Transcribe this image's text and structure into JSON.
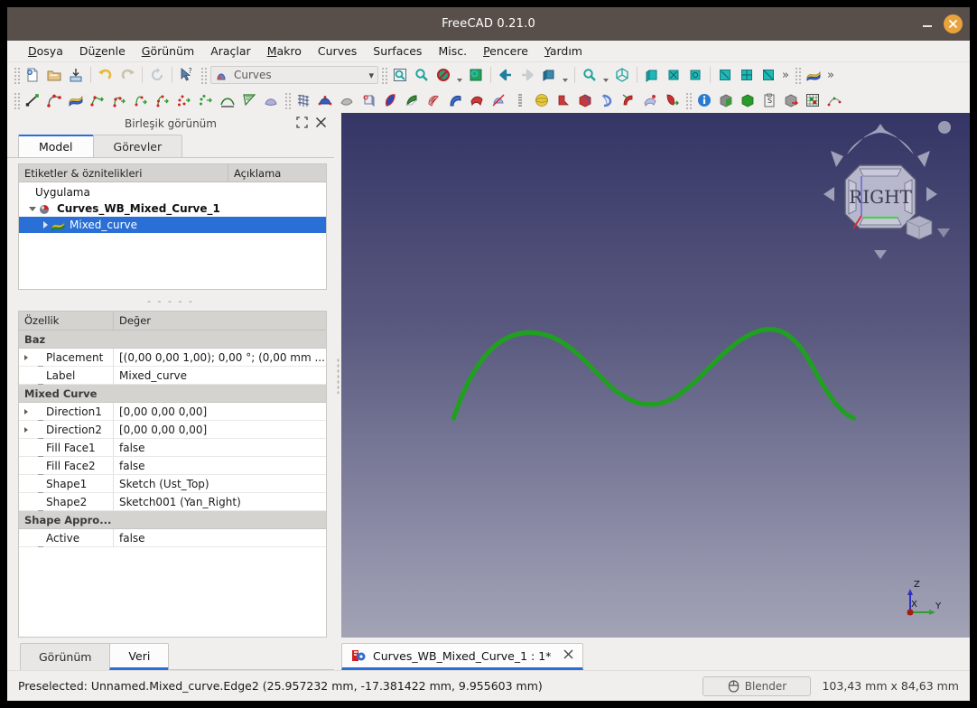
{
  "window": {
    "title": "FreeCAD 0.21.0",
    "minimize_label": "—",
    "close_label": "✕"
  },
  "menubar": {
    "items": [
      {
        "label": "Dosya",
        "accel": "D"
      },
      {
        "label": "Düzenle",
        "accel": "z"
      },
      {
        "label": "Görünüm",
        "accel": "G"
      },
      {
        "label": "Araçlar",
        "accel": ""
      },
      {
        "label": "Makro",
        "accel": "M"
      },
      {
        "label": "Curves",
        "accel": ""
      },
      {
        "label": "Surfaces",
        "accel": ""
      },
      {
        "label": "Misc.",
        "accel": ""
      },
      {
        "label": "Pencere",
        "accel": "P"
      },
      {
        "label": "Yardım",
        "accel": "Y"
      }
    ]
  },
  "toolbar": {
    "workbench_selector": {
      "value": "Curves",
      "icon": "curves-workbench-icon"
    },
    "file_tools": [
      "new-document-icon",
      "open-document-icon",
      "save-document-icon"
    ],
    "edit_tools": [
      "undo-icon",
      "redo-icon",
      "refresh-icon",
      "whats-this-icon"
    ],
    "view_tools": [
      "fit-all-icon",
      "fit-selection-icon",
      "draw-style-icon",
      "view-section-icon"
    ],
    "nav_tools": [
      "back-arrow-icon",
      "forward-arrow-icon",
      "axonometric-icon",
      "zoom-icon",
      "isometric-icon"
    ],
    "std_views": [
      "front-view-icon",
      "top-view-icon",
      "right-view-icon",
      "rear-view-icon",
      "bottom-view-icon",
      "left-view-icon"
    ],
    "overflow_label": "»"
  },
  "left_panel": {
    "header_title": "Birleşik görünüm",
    "float_icon": "float-window-icon",
    "close_icon": "close-panel-icon",
    "tabs": [
      {
        "label": "Model",
        "active": true
      },
      {
        "label": "Görevler",
        "active": false
      }
    ],
    "tree": {
      "columns": [
        "Etiketler & öznitelikleri",
        "Açıklama"
      ],
      "rows": [
        {
          "label": "Uygulama",
          "depth": 0,
          "expander": "none",
          "icon": "none",
          "bold": false,
          "selected": false
        },
        {
          "label": "Curves_WB_Mixed_Curve_1",
          "depth": 1,
          "expander": "down",
          "icon": "document-icon",
          "bold": true,
          "selected": false
        },
        {
          "label": "Mixed_curve",
          "depth": 2,
          "expander": "right",
          "icon": "mixed-curve-icon",
          "bold": false,
          "selected": true
        }
      ]
    },
    "separator": "- - - - -",
    "properties": {
      "columns": [
        "Özellik",
        "Değer"
      ],
      "rows": [
        {
          "type": "group",
          "name": "Baz"
        },
        {
          "type": "prop",
          "name": "Placement",
          "value": "[(0,00 0,00 1,00); 0,00 °; (0,00 mm  ...",
          "expandable": true
        },
        {
          "type": "prop",
          "name": "Label",
          "value": "Mixed_curve",
          "expandable": false
        },
        {
          "type": "group",
          "name": "Mixed Curve"
        },
        {
          "type": "prop",
          "name": "Direction1",
          "value": "[0,00 0,00 0,00]",
          "expandable": true
        },
        {
          "type": "prop",
          "name": "Direction2",
          "value": "[0,00 0,00 0,00]",
          "expandable": true
        },
        {
          "type": "prop",
          "name": "Fill Face1",
          "value": "false",
          "expandable": false
        },
        {
          "type": "prop",
          "name": "Fill Face2",
          "value": "false",
          "expandable": false
        },
        {
          "type": "prop",
          "name": "Shape1",
          "value": "Sketch (Ust_Top)",
          "expandable": false
        },
        {
          "type": "prop",
          "name": "Shape2",
          "value": "Sketch001 (Yan_Right)",
          "expandable": false
        },
        {
          "type": "group",
          "name": "Shape Appro..."
        },
        {
          "type": "prop",
          "name": "Active",
          "value": "false",
          "expandable": false
        }
      ]
    },
    "bottom_tabs": [
      {
        "label": "Görünüm",
        "active": false
      },
      {
        "label": "Veri",
        "active": true
      }
    ]
  },
  "viewport": {
    "navigation_cube": {
      "face_label": "RIGHT",
      "top_arrow": "nav-arrow-up-icon",
      "bottom_arrow": "nav-arrow-down-icon",
      "left_arrow": "nav-arrow-left-icon",
      "right_arrow": "nav-arrow-right-icon",
      "rotate_left": "rotate-ccw-icon",
      "rotate_right": "rotate-cw-icon",
      "corner_dot": "nav-dot-icon",
      "mini_cube": "nav-mini-cube-icon"
    },
    "axis_indicator": {
      "x_label": "X",
      "y_label": "Y",
      "z_label": "Z",
      "x_color": "#c03020",
      "y_color": "#2fa02f",
      "z_color": "#3030c0"
    },
    "curve_color": "#20a020",
    "background_top": "#353566",
    "background_bottom": "#a3a3b6"
  },
  "document_tab": {
    "label": "Curves_WB_Mixed_Curve_1 : 1*",
    "icon": "freecad-document-icon",
    "close_label": "✕"
  },
  "statusbar": {
    "message": "Preselected: Unnamed.Mixed_curve.Edge2 (25.957232 mm, -17.381422 mm, 9.955603 mm)",
    "nav_style_button": {
      "label": "Blender",
      "icon": "mouse-icon"
    },
    "dimensions": "103,43 mm x 84,63 mm"
  }
}
